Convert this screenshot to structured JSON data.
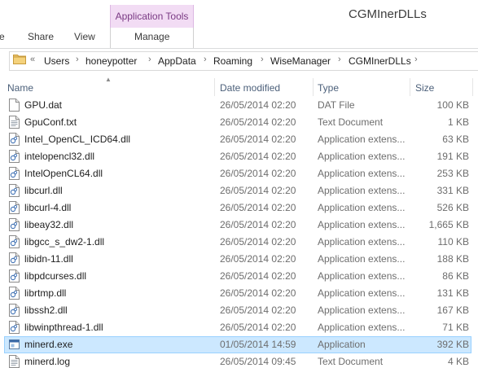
{
  "ribbon": {
    "context_group": "Application Tools",
    "window_title": "CGMInerDLLs",
    "tabs": [
      {
        "label": "e"
      },
      {
        "label": "Share"
      },
      {
        "label": "View"
      },
      {
        "label": "Manage"
      }
    ]
  },
  "address": {
    "overflow": "«",
    "crumbs": [
      "Users",
      "honeypotter",
      "AppData",
      "Roaming",
      "WiseManager",
      "CGMInerDLLs"
    ]
  },
  "columns": {
    "name": "Name",
    "date": "Date modified",
    "type": "Type",
    "size": "Size"
  },
  "files": [
    {
      "name": "GPU.dat",
      "date": "26/05/2014 02:20",
      "type": "DAT File",
      "size": "100 KB",
      "icon": "generic-file-icon"
    },
    {
      "name": "GpuConf.txt",
      "date": "26/05/2014 02:20",
      "type": "Text Document",
      "size": "1 KB",
      "icon": "text-file-icon"
    },
    {
      "name": "Intel_OpenCL_ICD64.dll",
      "date": "26/05/2014 02:20",
      "type": "Application extens...",
      "size": "63 KB",
      "icon": "dll-file-icon"
    },
    {
      "name": "intelopencl32.dll",
      "date": "26/05/2014 02:20",
      "type": "Application extens...",
      "size": "191 KB",
      "icon": "dll-file-icon"
    },
    {
      "name": "IntelOpenCL64.dll",
      "date": "26/05/2014 02:20",
      "type": "Application extens...",
      "size": "253 KB",
      "icon": "dll-file-icon"
    },
    {
      "name": "libcurl.dll",
      "date": "26/05/2014 02:20",
      "type": "Application extens...",
      "size": "331 KB",
      "icon": "dll-file-icon"
    },
    {
      "name": "libcurl-4.dll",
      "date": "26/05/2014 02:20",
      "type": "Application extens...",
      "size": "526 KB",
      "icon": "dll-file-icon"
    },
    {
      "name": "libeay32.dll",
      "date": "26/05/2014 02:20",
      "type": "Application extens...",
      "size": "1,665 KB",
      "icon": "dll-file-icon"
    },
    {
      "name": "libgcc_s_dw2-1.dll",
      "date": "26/05/2014 02:20",
      "type": "Application extens...",
      "size": "110 KB",
      "icon": "dll-file-icon"
    },
    {
      "name": "libidn-11.dll",
      "date": "26/05/2014 02:20",
      "type": "Application extens...",
      "size": "188 KB",
      "icon": "dll-file-icon"
    },
    {
      "name": "libpdcurses.dll",
      "date": "26/05/2014 02:20",
      "type": "Application extens...",
      "size": "86 KB",
      "icon": "dll-file-icon"
    },
    {
      "name": "librtmp.dll",
      "date": "26/05/2014 02:20",
      "type": "Application extens...",
      "size": "131 KB",
      "icon": "dll-file-icon"
    },
    {
      "name": "libssh2.dll",
      "date": "26/05/2014 02:20",
      "type": "Application extens...",
      "size": "167 KB",
      "icon": "dll-file-icon"
    },
    {
      "name": "libwinpthread-1.dll",
      "date": "26/05/2014 02:20",
      "type": "Application extens...",
      "size": "71 KB",
      "icon": "dll-file-icon"
    },
    {
      "name": "minerd.exe",
      "date": "01/05/2014 14:59",
      "type": "Application",
      "size": "392 KB",
      "icon": "exe-file-icon",
      "selected": true
    },
    {
      "name": "minerd.log",
      "date": "26/05/2014 09:45",
      "type": "Text Document",
      "size": "4 KB",
      "icon": "text-file-icon"
    }
  ],
  "colors": {
    "context_band": "#f2dcf4",
    "selection": "#cce8ff",
    "selection_border": "#99d1ff",
    "header_text": "#4c607a"
  }
}
